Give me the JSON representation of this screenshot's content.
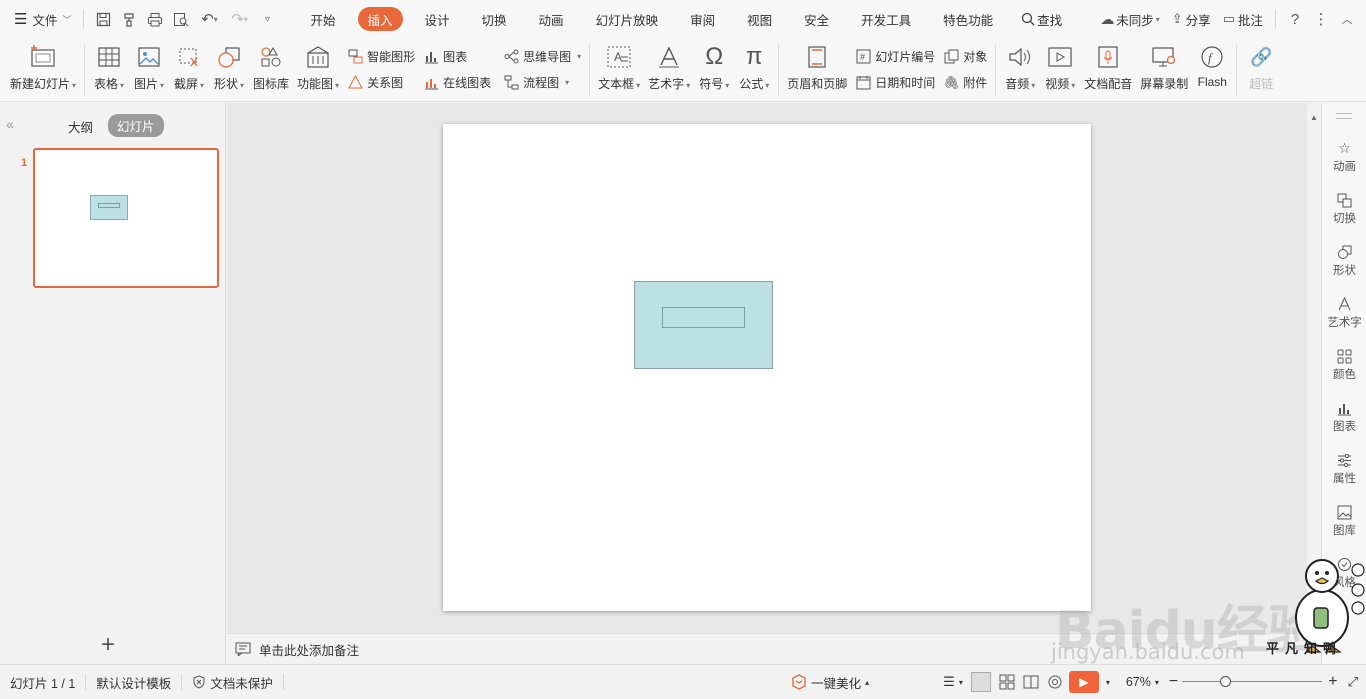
{
  "menubar": {
    "file_label": "文件",
    "tabs": [
      "开始",
      "插入",
      "设计",
      "切换",
      "动画",
      "幻灯片放映",
      "审阅",
      "视图",
      "安全",
      "开发工具",
      "特色功能"
    ],
    "active_tab": "插入",
    "search_label": "查找",
    "sync_label": "未同步",
    "share_label": "分享",
    "comment_label": "批注"
  },
  "ribbon": {
    "new_slide": "新建幻灯片",
    "table": "表格",
    "picture": "图片",
    "screenshot": "截屏",
    "shape": "形状",
    "icon_lib": "图标库",
    "function_chart": "功能图",
    "smart_shape": "智能图形",
    "relation_chart": "关系图",
    "chart": "图表",
    "online_chart": "在线图表",
    "mindmap": "思维导图",
    "flowchart": "流程图",
    "textbox": "文本框",
    "wordart": "艺术字",
    "symbol": "符号",
    "formula": "公式",
    "header_footer": "页眉和页脚",
    "slide_number": "幻灯片编号",
    "date_time": "日期和时间",
    "object": "对象",
    "attachment": "附件",
    "audio": "音频",
    "video": "视频",
    "doc_voice": "文档配音",
    "screen_record": "屏幕录制",
    "flash": "Flash",
    "hyperlink": "超链"
  },
  "leftpanel": {
    "tab_outline": "大纲",
    "tab_slides": "幻灯片",
    "slide_number": "1"
  },
  "notes": {
    "placeholder": "单击此处添加备注"
  },
  "rightpanel": {
    "items": [
      "动画",
      "切换",
      "形状",
      "艺术字",
      "颜色",
      "图表",
      "属性",
      "图库",
      "风格"
    ]
  },
  "statusbar": {
    "slide_info": "幻灯片 1 / 1",
    "template": "默认设计模板",
    "protect": "文档未保护",
    "beautify": "一键美化",
    "zoom": "67%"
  },
  "watermark": {
    "brand": "Baidu经验",
    "url": "jingyan.baidu.com",
    "mascot_caption": "平凡知鸭"
  },
  "colors": {
    "accent": "#e9683b",
    "shape_fill": "#bce0e4",
    "play_button": "#f0643c"
  }
}
